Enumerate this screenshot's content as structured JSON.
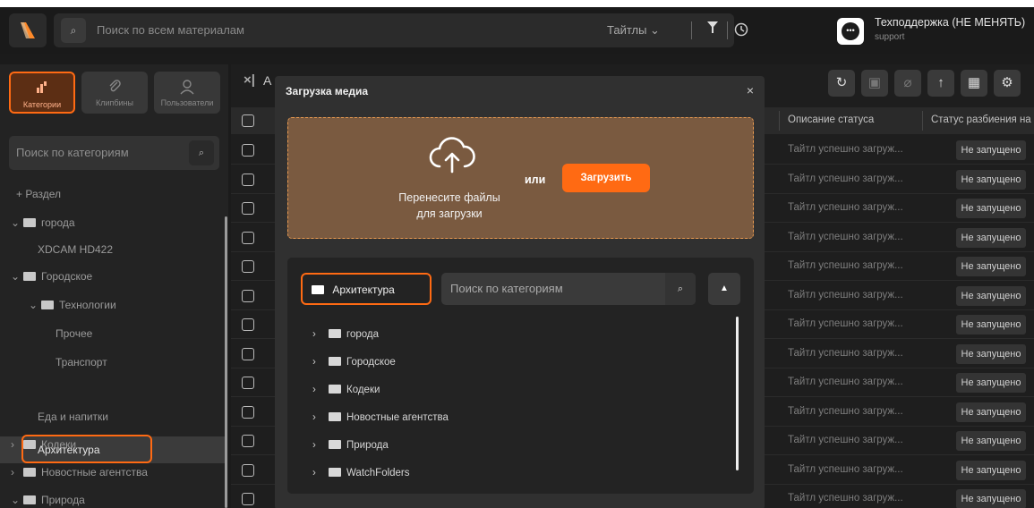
{
  "topbar": {
    "search_placeholder": "Поиск по всем материалам",
    "scope": "Тайтлы ⌄",
    "filter_icon": "filter-icon",
    "history_icon": "clock-icon",
    "user_name": "Техподдержка (НЕ МЕНЯТЬ)",
    "user_role": "support",
    "brand_color": "#ff6a13"
  },
  "sidebar": {
    "tabs": [
      {
        "label": "Категории",
        "icon": "tree-icon",
        "active": true
      },
      {
        "label": "Клипбины",
        "icon": "paperclip-icon",
        "active": false
      },
      {
        "label": "Пользователи",
        "icon": "user-icon",
        "active": false
      }
    ],
    "search_placeholder": "Поиск по категориям",
    "add_section": "+ Раздел",
    "tree": [
      {
        "label": "города",
        "expanded": true
      },
      {
        "label": "XDCAM HD422"
      },
      {
        "label": "Городское",
        "expanded": true
      },
      {
        "label": "Технологии",
        "expanded": true
      },
      {
        "label": "Прочее"
      },
      {
        "label": "Транспорт"
      },
      {
        "label": "Архитектура",
        "selected": true
      },
      {
        "label": "Еда и напитки"
      },
      {
        "label": "Кодеки"
      },
      {
        "label": "Новостные агентства"
      },
      {
        "label": "Природа",
        "expanded": true
      }
    ]
  },
  "main": {
    "title_fragment": "А",
    "columns": {
      "status_desc": "Описание статуса",
      "split_status": "Статус разбиения на"
    },
    "rows": [
      {
        "desc": "Тайтл успешно загруж...",
        "status": "Не запущено"
      },
      {
        "desc": "Тайтл успешно загруж...",
        "status": "Не запущено"
      },
      {
        "desc": "Тайтл успешно загруж...",
        "status": "Не запущено"
      },
      {
        "desc": "Тайтл успешно загруж...",
        "status": "Не запущено"
      },
      {
        "desc": "Тайтл успешно загруж...",
        "status": "Не запущено"
      },
      {
        "desc": "Тайтл успешно загруж...",
        "status": "Не запущено"
      },
      {
        "desc": "Тайтл успешно загруж...",
        "status": "Не запущено"
      },
      {
        "desc": "Тайтл успешно загруж...",
        "status": "Не запущено"
      },
      {
        "desc": "Тайтл успешно загруж...",
        "status": "Не запущено"
      },
      {
        "desc": "Тайтл успешно загруж...",
        "status": "Не запущено"
      },
      {
        "desc": "Тайтл успешно загруж...",
        "status": "Не запущено"
      },
      {
        "desc": "Тайтл успешно загруж...",
        "status": "Не запущено"
      },
      {
        "desc": "Тайтл успешно загруж...",
        "status": "Не запущено"
      }
    ],
    "toolbar_icons": [
      "refresh-icon",
      "calendar-icon",
      "paperclip-icon",
      "upload-arrow-icon",
      "grid-icon",
      "gear-icon"
    ]
  },
  "modal": {
    "title": "Загрузка медиа",
    "close": "×",
    "drop_text_1": "Перенесите файлы",
    "drop_text_2": "для загрузки",
    "or": "или",
    "upload_button": "Загрузить",
    "current_category": "Архитектура",
    "search_placeholder": "Поиск по категориям",
    "tree": [
      "города",
      "Городское",
      "Кодеки",
      "Новостные агентства",
      "Природа",
      "WatchFolders"
    ]
  }
}
